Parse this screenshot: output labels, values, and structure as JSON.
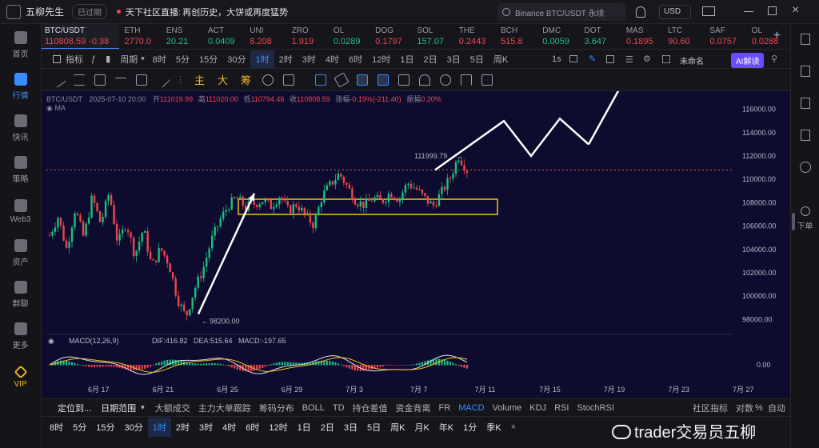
{
  "app": {
    "name": "五柳先生",
    "status": "已过期",
    "broadcast_prefix": "天下社区直播:",
    "broadcast": "再创历史，大饼或再度猛势",
    "search": "Binance BTC/USDT 永续",
    "currency": "USD"
  },
  "sidebar": [
    {
      "label": "首页",
      "active": false
    },
    {
      "label": "行情",
      "active": true
    },
    {
      "label": "快讯",
      "active": false
    },
    {
      "label": "策略",
      "active": false
    },
    {
      "label": "Web3",
      "active": false
    },
    {
      "label": "资产",
      "active": false
    },
    {
      "label": "群聊",
      "active": false
    },
    {
      "label": "更多",
      "active": false
    },
    {
      "label": "VIP",
      "active": false
    }
  ],
  "right_sidebar": {
    "label": "下单"
  },
  "tickers": [
    {
      "name": "BTC/USDT",
      "price": "110808.59",
      "change": "-0.38",
      "dir": "dn"
    },
    {
      "name": "ETH",
      "price": "2770.0",
      "dir": "dn"
    },
    {
      "name": "ENS",
      "price": "20.21",
      "dir": "up"
    },
    {
      "name": "ACT",
      "price": "0.0409",
      "dir": "up"
    },
    {
      "name": "UNI",
      "price": "8.208",
      "dir": "dn"
    },
    {
      "name": "ZRO",
      "price": "1.919",
      "dir": "dn"
    },
    {
      "name": "OL",
      "price": "0.0289",
      "dir": "up"
    },
    {
      "name": "DOG",
      "price": "0.1797",
      "dir": "dn"
    },
    {
      "name": "SOL",
      "price": "157.07",
      "dir": "up"
    },
    {
      "name": "THE",
      "price": "0.2443",
      "dir": "dn"
    },
    {
      "name": "BCH",
      "price": "515.8",
      "dir": "dn"
    },
    {
      "name": "DMC",
      "price": "0.0059",
      "dir": "up"
    },
    {
      "name": "DOT",
      "price": "3.647",
      "dir": "up"
    },
    {
      "name": "MAS",
      "price": "0.1895",
      "dir": "dn"
    },
    {
      "name": "LTC",
      "price": "90.60",
      "dir": "dn"
    },
    {
      "name": "SAF",
      "price": "0.0757",
      "dir": "dn"
    },
    {
      "name": "OL",
      "price": "0.0288",
      "dir": "dn"
    }
  ],
  "timeframes": {
    "indicator": "指标",
    "period": "周期",
    "items": [
      "8时",
      "5分",
      "15分",
      "30分",
      "1时",
      "2时",
      "3时",
      "4时",
      "6时",
      "12时",
      "1日",
      "2日",
      "3日",
      "5日",
      "周K"
    ],
    "active": "1时",
    "right": "1s",
    "unnamed": "未命名",
    "ai": "AI解读"
  },
  "drawbar": [
    "主",
    "大",
    "筹"
  ],
  "chart_info": {
    "pair": "BTC/USDT",
    "date": "2025-07-10 20:00",
    "open_l": "开",
    "open": "111019.99",
    "high_l": "高",
    "high": "111020.00",
    "low_l": "低",
    "low": "110794.46",
    "close_l": "收",
    "close": "110808.59",
    "chg_l": "涨幅",
    "chg": "-0.19%(-211.40)",
    "amp_l": "振幅",
    "amp": "0.20%",
    "ma": "MA"
  },
  "annotations": {
    "high": "111999.79",
    "low": "98200.00"
  },
  "macd": {
    "label": "MACD(12,26,9)",
    "dif": "DIF:416.82",
    "dea": "DEA:515.64",
    "macd": "MACD:-197.65",
    "zero": "0.00"
  },
  "chart_data": {
    "type": "candlestick",
    "y_ticks": [
      "116000.00",
      "114000.00",
      "112000.00",
      "110000.00",
      "108000.00",
      "106000.00",
      "104000.00",
      "102000.00",
      "100000.00",
      "98000.00"
    ],
    "x_ticks": [
      "6月 17",
      "6月 21",
      "6月 25",
      "6月 29",
      "7月 3",
      "7月 7",
      "7月 11",
      "7月 15",
      "7月 19",
      "7月 23",
      "7月 27"
    ],
    "y_range": [
      97000,
      117000
    ],
    "price_path": [
      105200,
      106800,
      104000,
      107500,
      105000,
      108500,
      106200,
      108900,
      104500,
      106300,
      103500,
      105800,
      102500,
      104100,
      102800,
      99800,
      98200,
      100600,
      102300,
      104800,
      106500,
      107800,
      108400,
      107600,
      107900,
      108200,
      107700,
      108600,
      107300,
      107900,
      106900,
      106100,
      108600,
      109600,
      110500,
      109300,
      108100,
      107800,
      108400,
      108100,
      108900,
      108300,
      109700,
      109200,
      108400,
      107700,
      108900,
      110100,
      111999,
      110808
    ],
    "projection": [
      110808,
      115000,
      112000,
      115200,
      113000,
      119300
    ],
    "box": [
      107000,
      108300
    ],
    "current_line": 110808
  },
  "indicators": {
    "locate": "定位到...",
    "range": "日期范围",
    "items": [
      "大额成交",
      "主力大单跟踪",
      "筹码分布",
      "BOLL",
      "TD",
      "持仓差值",
      "资金背离",
      "FR",
      "MACD",
      "Volume",
      "KDJ",
      "RSI",
      "StochRSI"
    ],
    "community": "社区指标",
    "log": "对数",
    "pct": "%",
    "auto": "自动"
  },
  "timeframes2": [
    "8时",
    "5分",
    "15分",
    "30分",
    "1时",
    "2时",
    "3时",
    "4时",
    "6时",
    "12时",
    "1日",
    "2日",
    "3日",
    "5日",
    "周K",
    "月K",
    "年K",
    "1分",
    "季K"
  ],
  "watermark": "trader交易员五柳"
}
